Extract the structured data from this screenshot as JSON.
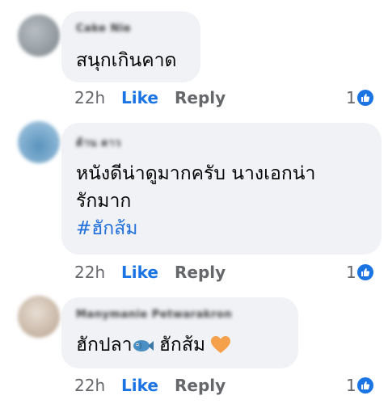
{
  "comments": [
    {
      "author": "Cake Nie",
      "text_lines": [
        "สนุกเกินคาด"
      ],
      "time": "22h",
      "like_label": "Like",
      "reply_label": "Reply",
      "reaction_count": "1",
      "avatar_color": "#9aa3a8"
    },
    {
      "author": "ต้าน ดาว",
      "text_lines": [
        "หนังดีน่าดูมากครับ นางเอกน่า",
        "รักมาก"
      ],
      "hashtag": "#ฮักส้ม",
      "time": "22h",
      "like_label": "Like",
      "reply_label": "Reply",
      "reaction_count": "1",
      "avatar_color": "#7fb4d8"
    },
    {
      "author": "Manymanie Petwarakron",
      "text_parts": [
        "ฮักปลา",
        " ฮักส้ม "
      ],
      "time": "22h",
      "like_label": "Like",
      "reply_label": "Reply",
      "reaction_count": "1",
      "avatar_color": "#c9b9a8"
    }
  ],
  "icons": {
    "fish": "fish-emoji",
    "heart": "orange-heart-emoji",
    "like": "thumbs-up-reaction"
  },
  "colors": {
    "bubble": "#f0f2f5",
    "like_blue": "#1b74e4",
    "hashtag": "#216fdb",
    "heart": "#f5a04a"
  }
}
